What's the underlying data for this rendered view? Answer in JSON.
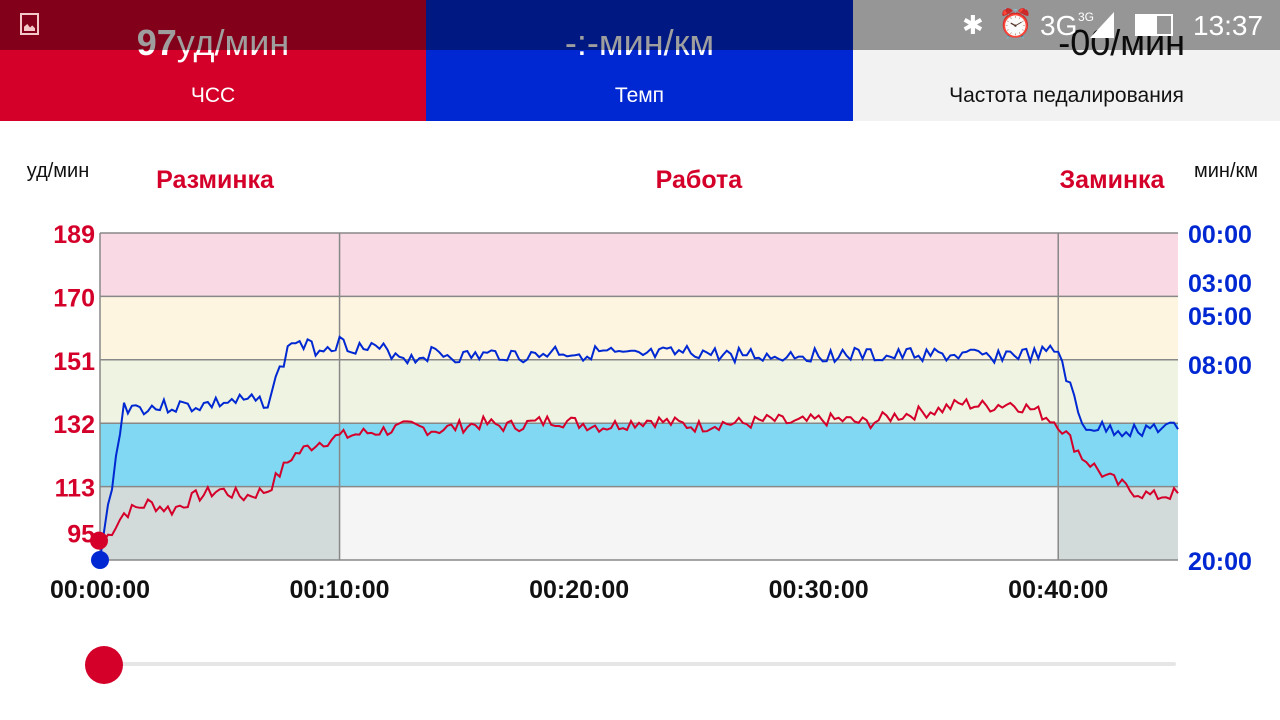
{
  "status_bar": {
    "time": "13:37",
    "network": "3G",
    "network_small": "3G"
  },
  "tiles": [
    {
      "value": "97",
      "unit": "уд/мин",
      "label": "ЧСС",
      "color": "#d4002a"
    },
    {
      "value": "-:-",
      "unit": "мин/км",
      "label": "Темп",
      "color": "#0028d2"
    },
    {
      "value": "-00",
      "unit": "/мин",
      "label": "Частота педалирования",
      "color": "#f2f2f2"
    }
  ],
  "chart_data": {
    "type": "line",
    "left_axis_label": "уд/мин",
    "right_axis_label": "мин/км",
    "phases": [
      {
        "name": "Разминка",
        "start": 0,
        "end": 10
      },
      {
        "name": "Работа",
        "start": 10,
        "end": 40
      },
      {
        "name": "Заминка",
        "start": 40,
        "end": 45
      }
    ],
    "hr_ticks": [
      189,
      170,
      151,
      132,
      113,
      95
    ],
    "hr_range": [
      91,
      189
    ],
    "pace_ticks": [
      {
        "label": "00:00",
        "v": 0
      },
      {
        "label": "03:00",
        "v": 3
      },
      {
        "label": "05:00",
        "v": 5
      },
      {
        "label": "08:00",
        "v": 8
      },
      {
        "label": "20:00",
        "v": 20
      }
    ],
    "pace_range": [
      0,
      20
    ],
    "x_ticks": [
      {
        "label": "00:00:00",
        "v": 0
      },
      {
        "label": "00:10:00",
        "v": 10
      },
      {
        "label": "00:20:00",
        "v": 20
      },
      {
        "label": "00:30:00",
        "v": 30
      },
      {
        "label": "00:40:00",
        "v": 40
      }
    ],
    "x_range": [
      0,
      45
    ],
    "zones": [
      {
        "from": 170,
        "to": 189,
        "color": "#f8d9e4"
      },
      {
        "from": 151,
        "to": 170,
        "color": "#fdf5e0"
      },
      {
        "from": 132,
        "to": 151,
        "color": "#eff4e2"
      },
      {
        "from": 113,
        "to": 132,
        "color": "#80d8f2"
      },
      {
        "from": 95,
        "to": 113,
        "color": "#f5f5f5"
      }
    ],
    "series": [
      {
        "name": "ЧСС",
        "color": "#d4002a",
        "values": [
          95,
          105,
          108,
          106,
          110,
          112,
          110,
          112,
          122,
          126,
          128,
          129,
          130,
          131,
          130,
          131,
          132,
          131,
          132,
          133,
          132,
          131,
          132,
          133,
          132,
          131,
          132,
          132,
          133,
          132,
          133,
          133,
          132,
          134,
          135,
          136,
          138,
          137,
          138,
          136,
          132,
          122,
          116,
          112,
          110,
          111
        ]
      },
      {
        "name": "Темп",
        "color": "#0028d2",
        "values": [
          20,
          10.6,
          10.7,
          10.6,
          10.6,
          10.4,
          10.3,
          10.3,
          6.6,
          7.1,
          6.7,
          7.1,
          7.2,
          7.7,
          7.3,
          7.6,
          7.5,
          7.4,
          7.6,
          7.2,
          7.4,
          7.3,
          7.6,
          7.5,
          7.4,
          7.3,
          7.5,
          7.4,
          7.6,
          7.4,
          7.5,
          7.4,
          7.5,
          7.6,
          7.4,
          7.5,
          7.5,
          7.6,
          7.4,
          7.5,
          7.2,
          11.8,
          12.0,
          12.1,
          11.9,
          12.0
        ]
      }
    ]
  }
}
